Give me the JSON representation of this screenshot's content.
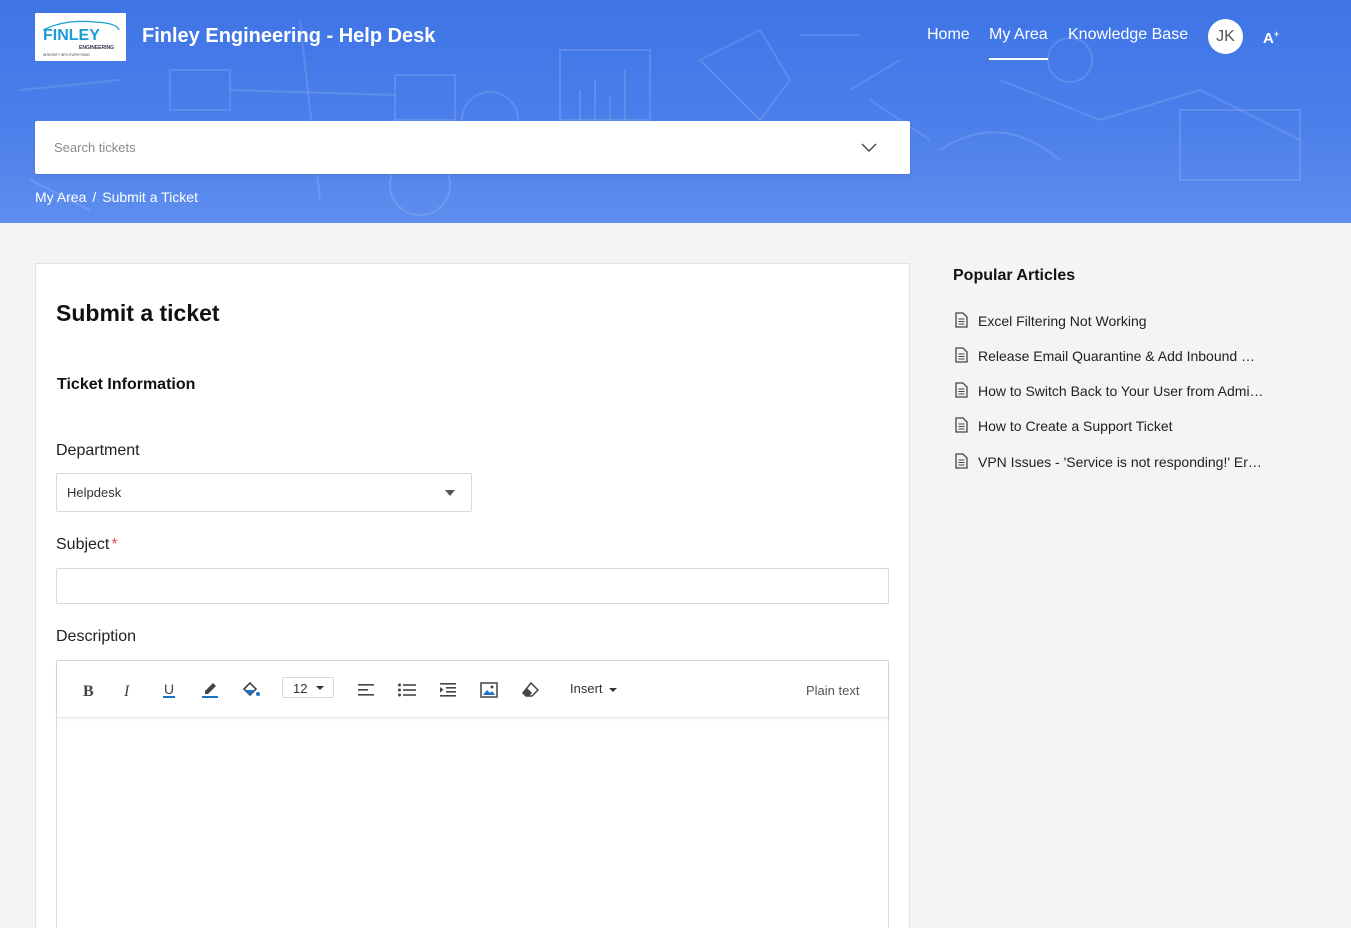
{
  "header": {
    "logo": {
      "brand_text": "FINLEY",
      "sub_text": "ENGINEERING",
      "tagline": "INTEGRITY INTO EVERYTHING"
    },
    "site_title": "Finley Engineering - Help Desk",
    "nav": [
      {
        "label": "Home",
        "active": false
      },
      {
        "label": "My Area",
        "active": true
      },
      {
        "label": "Knowledge Base",
        "active": false
      }
    ],
    "avatar_initials": "JK",
    "font_toggle": "A",
    "font_toggle_sup": "+"
  },
  "search": {
    "placeholder": "Search tickets",
    "icon": "chevron-down-icon"
  },
  "breadcrumb": [
    "My Area",
    "Submit a Ticket"
  ],
  "breadcrumb_separator": "/",
  "form": {
    "title": "Submit a ticket",
    "section": "Ticket Information",
    "department_label": "Department",
    "department_value": "Helpdesk",
    "subject_label": "Subject",
    "subject_required": "*",
    "subject_value": "",
    "description_label": "Description",
    "editor": {
      "font_size": "12",
      "insert_label": "Insert",
      "plain_text_label": "Plain text",
      "tools": [
        "bold-icon",
        "italic-icon",
        "underline-icon",
        "text-color-icon",
        "background-color-icon",
        "align-left-icon",
        "bullet-list-icon",
        "indent-icon",
        "image-icon",
        "clear-format-icon"
      ]
    }
  },
  "sidebar": {
    "title": "Popular Articles",
    "articles": [
      "Excel Filtering Not Working",
      "Release Email Quarantine & Add Inbound …",
      "How to Switch Back to Your User from Admi…",
      "How to Create a Support Ticket",
      "VPN Issues - 'Service is not responding!' Er…"
    ]
  },
  "colors": {
    "header_blue": "#4a7ee9",
    "accent_blue": "#1a73c8",
    "page_bg": "#f3f4f5",
    "required": "#d9534f"
  }
}
